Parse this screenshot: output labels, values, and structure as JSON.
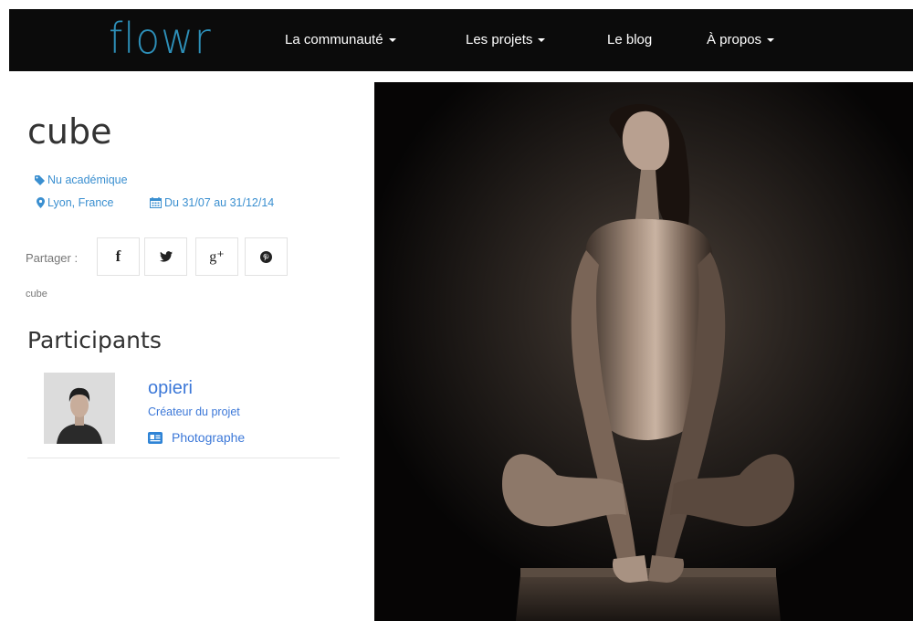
{
  "nav": {
    "logo": "flowr",
    "items": [
      {
        "label": "La communauté",
        "has_caret": true
      },
      {
        "label": "Les projets",
        "has_caret": true
      },
      {
        "label": "Le blog",
        "has_caret": false
      },
      {
        "label": "À propos",
        "has_caret": true
      }
    ]
  },
  "project": {
    "title": "cube",
    "category": "Nu académique",
    "location": "Lyon, France",
    "dates": "Du 31/07 au 31/12/14",
    "tag": "cube"
  },
  "share": {
    "label": "Partager :",
    "buttons": [
      {
        "icon": "facebook-icon",
        "glyph": "f"
      },
      {
        "icon": "twitter-icon",
        "glyph": ""
      },
      {
        "icon": "google-plus-icon",
        "glyph": "g⁺"
      },
      {
        "icon": "pinterest-icon",
        "glyph": ""
      }
    ]
  },
  "participants": {
    "title": "Participants",
    "list": [
      {
        "name": "opieri",
        "role": "Créateur du projet",
        "profession": "Photographe"
      }
    ]
  },
  "colors": {
    "nav_bg": "#0b0b0b",
    "logo": "#2d8fb8",
    "link": "#3a8fd0",
    "participant_link": "#3c78d8"
  }
}
